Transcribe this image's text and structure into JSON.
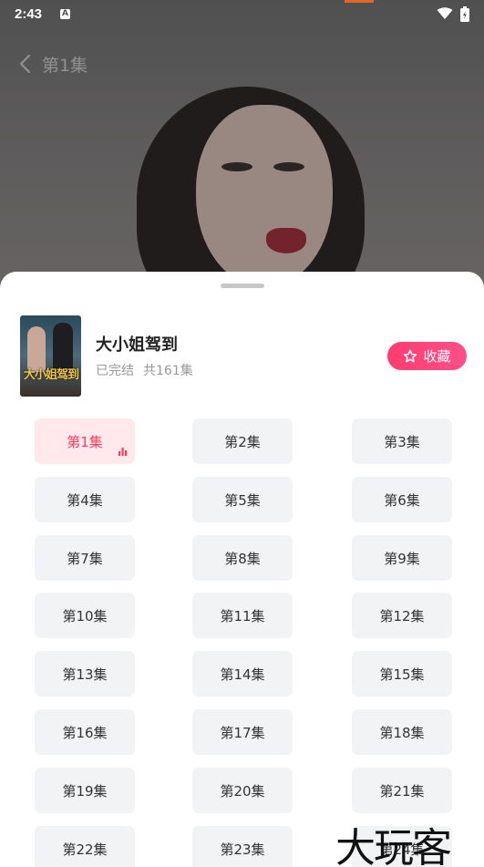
{
  "status_bar": {
    "time": "2:43",
    "notification_icon": "a-icon",
    "wifi_icon": "wifi-icon",
    "battery_icon": "battery-icon"
  },
  "header": {
    "back_icon": "chevron-left-icon",
    "title": "第1集"
  },
  "drama": {
    "poster_title": "大小姐驾到",
    "title": "大小姐驾到",
    "status": "已完结",
    "count": "共161集",
    "favorite_label": "收藏"
  },
  "episodes": [
    {
      "label": "第1集",
      "active": true
    },
    {
      "label": "第2集"
    },
    {
      "label": "第3集"
    },
    {
      "label": "第4集"
    },
    {
      "label": "第5集"
    },
    {
      "label": "第6集"
    },
    {
      "label": "第7集"
    },
    {
      "label": "第8集"
    },
    {
      "label": "第9集"
    },
    {
      "label": "第10集"
    },
    {
      "label": "第11集"
    },
    {
      "label": "第12集"
    },
    {
      "label": "第13集"
    },
    {
      "label": "第14集"
    },
    {
      "label": "第15集"
    },
    {
      "label": "第16集"
    },
    {
      "label": "第17集"
    },
    {
      "label": "第18集"
    },
    {
      "label": "第19集"
    },
    {
      "label": "第20集"
    },
    {
      "label": "第21集"
    },
    {
      "label": "第22集"
    },
    {
      "label": "第23集"
    },
    {
      "label": "第24集"
    }
  ],
  "colors": {
    "accent": "#ff3b5c",
    "active_bg": "#ffe9ec",
    "tile_bg": "#f2f3f5"
  },
  "watermark": "大玩客"
}
